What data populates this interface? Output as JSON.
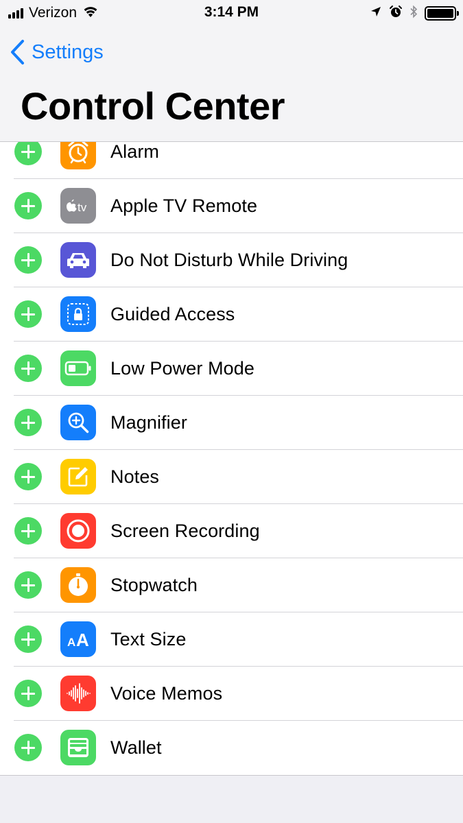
{
  "status_bar": {
    "carrier": "Verizon",
    "time": "3:14 PM",
    "icons": [
      "signal-icon",
      "wifi-icon",
      "location-icon",
      "alarm-clock-icon",
      "bluetooth-icon",
      "battery-icon"
    ],
    "battery_level": 1.0
  },
  "nav": {
    "back_label": "Settings",
    "title": "Control Center"
  },
  "colors": {
    "accent": "#147efb",
    "add_green": "#4cd964"
  },
  "items": [
    {
      "label": "Alarm",
      "icon": "alarm-clock-icon",
      "color": "#ff9500"
    },
    {
      "label": "Apple TV Remote",
      "icon": "apple-tv-icon",
      "color": "#8e8e93",
      "icon_text": "tv"
    },
    {
      "label": "Do Not Disturb While Driving",
      "icon": "car-icon",
      "color": "#5856d6"
    },
    {
      "label": "Guided Access",
      "icon": "lock-icon",
      "color": "#147efb"
    },
    {
      "label": "Low Power Mode",
      "icon": "battery-low-icon",
      "color": "#4cd964"
    },
    {
      "label": "Magnifier",
      "icon": "magnifier-icon",
      "color": "#147efb"
    },
    {
      "label": "Notes",
      "icon": "notes-icon",
      "color": "#ffcc00"
    },
    {
      "label": "Screen Recording",
      "icon": "record-icon",
      "color": "#ff3b30"
    },
    {
      "label": "Stopwatch",
      "icon": "stopwatch-icon",
      "color": "#ff9500"
    },
    {
      "label": "Text Size",
      "icon": "text-size-icon",
      "color": "#147efb",
      "icon_text": "AA"
    },
    {
      "label": "Voice Memos",
      "icon": "voice-memos-icon",
      "color": "#ff3b30"
    },
    {
      "label": "Wallet",
      "icon": "wallet-icon",
      "color": "#4cd964"
    }
  ]
}
